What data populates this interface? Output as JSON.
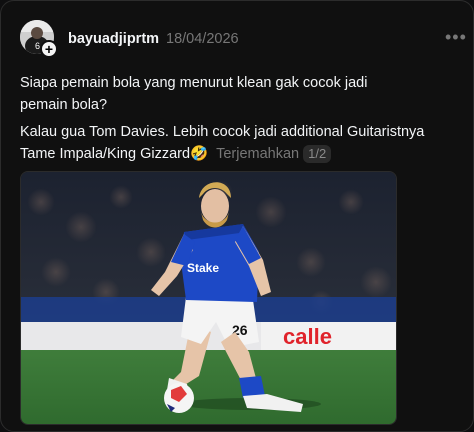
{
  "post": {
    "username": "bayuadjiprtm",
    "date": "18/04/2026",
    "more_label": "•••",
    "paragraph_1_line_1": "Siapa pemain bola yang menurut klean gak cocok jadi",
    "paragraph_1_line_2": "pemain bola?",
    "paragraph_2_line_1": "Kalau gua Tom Davies. Lebih cocok jadi additional Guitaristnya",
    "paragraph_2_line_2": "Tame Impala/King Gizzard",
    "emoji": "🤣",
    "translate_label": "Terjemahkan",
    "media_counter": "1/2",
    "shirt_number": "26",
    "shirt_sponsor": "Stake",
    "ad_board_text": "calle"
  },
  "icons": {
    "avatar": "avatar-image",
    "follow": "plus-icon",
    "more": "ellipsis-icon"
  },
  "colors": {
    "background": "#101010",
    "text": "#f3f5f7",
    "muted": "#777777",
    "kit_blue": "#1d49c6",
    "pitch_green": "#3d7b3a"
  }
}
